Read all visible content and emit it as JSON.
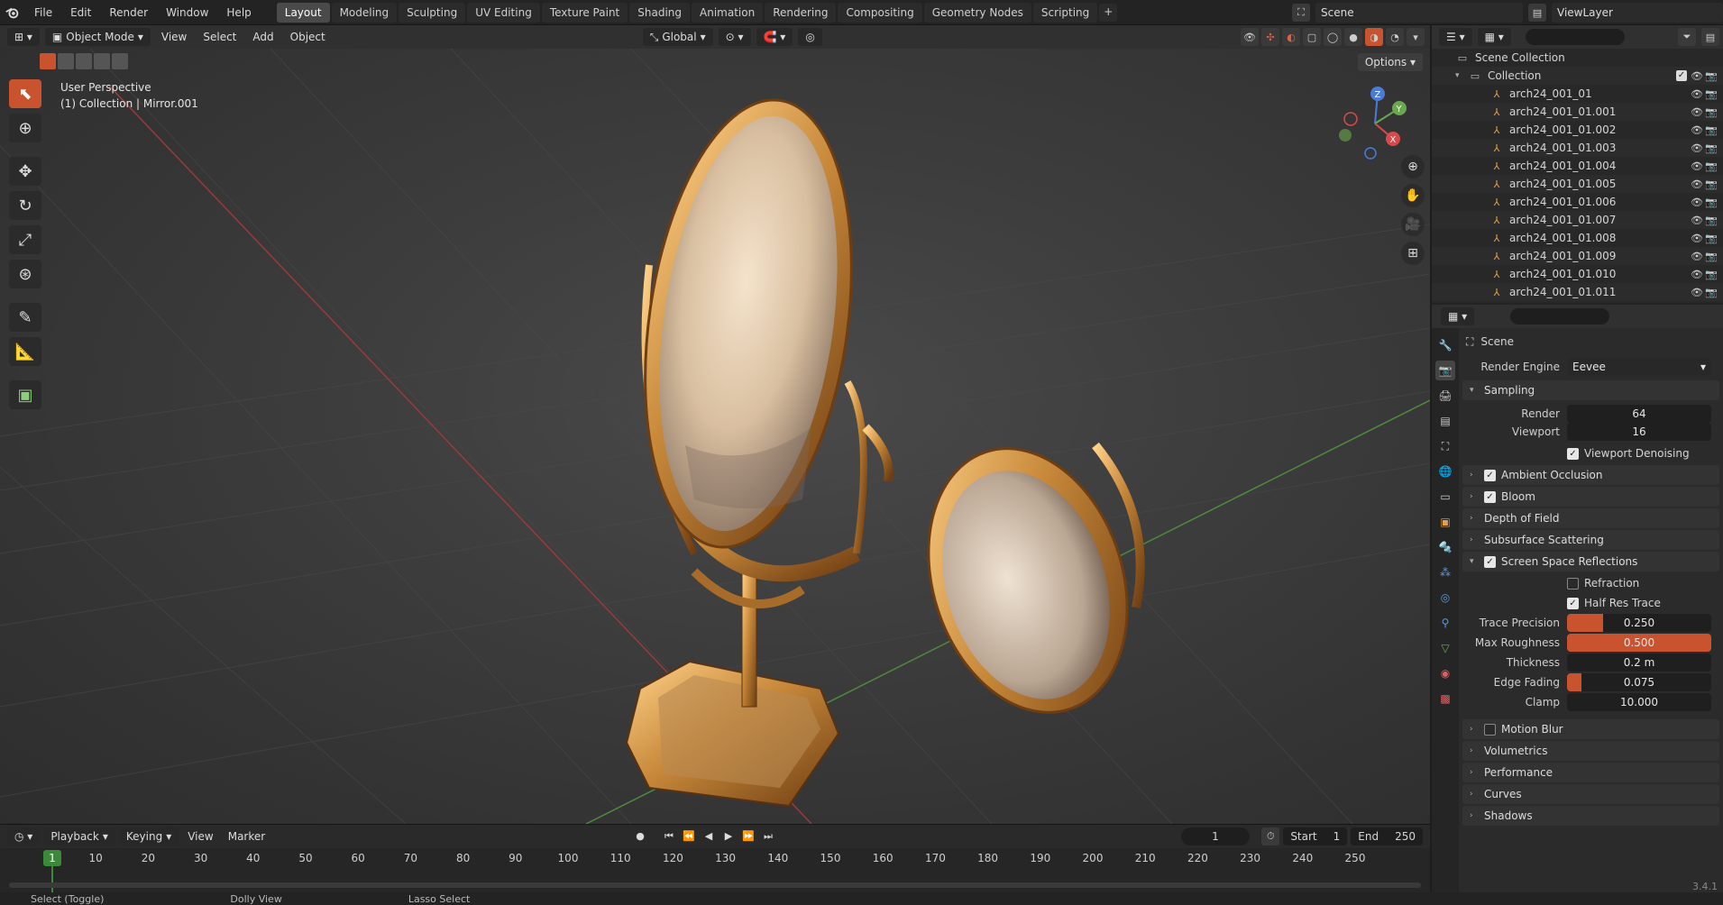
{
  "topbar": {
    "menus": [
      "File",
      "Edit",
      "Render",
      "Window",
      "Help"
    ],
    "workspaces": [
      "Layout",
      "Modeling",
      "Sculpting",
      "UV Editing",
      "Texture Paint",
      "Shading",
      "Animation",
      "Rendering",
      "Compositing",
      "Geometry Nodes",
      "Scripting"
    ],
    "active_workspace": "Layout",
    "add_tab": "+",
    "scene": "Scene",
    "view_layer": "ViewLayer"
  },
  "viewport_header": {
    "mode": "Object Mode",
    "menus": [
      "View",
      "Select",
      "Add",
      "Object"
    ],
    "transform_orientation": "Global",
    "options": "Options"
  },
  "viewport": {
    "perspective": "User Perspective",
    "context": "(1) Collection | Mirror.001",
    "gizmo_axes": [
      "Z",
      "Y",
      "X"
    ]
  },
  "timeline": {
    "menus": [
      "Playback",
      "Keying",
      "View",
      "Marker"
    ],
    "current_frame": "1",
    "frame_ticks": [
      "10",
      "20",
      "30",
      "40",
      "50",
      "60",
      "70",
      "80",
      "90",
      "100",
      "110",
      "120",
      "130",
      "140",
      "150",
      "160",
      "170",
      "180",
      "190",
      "200",
      "210",
      "220",
      "230",
      "240",
      "250"
    ],
    "current_frame_label": "1",
    "start_label": "Start",
    "start_value": "1",
    "end_label": "End",
    "end_value": "250"
  },
  "statusbar": {
    "items": [
      "Select (Toggle)",
      "Dolly View",
      "Lasso Select"
    ]
  },
  "outliner": {
    "scene_collection": "Scene Collection",
    "collection": "Collection",
    "objects": [
      "arch24_001_01",
      "arch24_001_01.001",
      "arch24_001_01.002",
      "arch24_001_01.003",
      "arch24_001_01.004",
      "arch24_001_01.005",
      "arch24_001_01.006",
      "arch24_001_01.007",
      "arch24_001_01.008",
      "arch24_001_01.009",
      "arch24_001_01.010",
      "arch24_001_01.011"
    ]
  },
  "properties": {
    "context": "Scene",
    "render_engine_label": "Render Engine",
    "render_engine": "Eevee",
    "sampling": {
      "title": "Sampling",
      "render_label": "Render",
      "render_value": "64",
      "viewport_label": "Viewport",
      "viewport_value": "16",
      "denoise_label": "Viewport Denoising"
    },
    "panels_top": [
      {
        "label": "Ambient Occlusion",
        "checkbox": true
      },
      {
        "label": "Bloom",
        "checkbox": true
      },
      {
        "label": "Depth of Field",
        "checkbox": null
      },
      {
        "label": "Subsurface Scattering",
        "checkbox": null
      }
    ],
    "ssr": {
      "title": "Screen Space Reflections",
      "refraction_label": "Refraction",
      "half_res_label": "Half Res Trace",
      "trace_precision_label": "Trace Precision",
      "trace_precision": "0.250",
      "trace_precision_fill": 0.25,
      "max_roughness_label": "Max Roughness",
      "max_roughness": "0.500",
      "max_roughness_fill": 1.0,
      "thickness_label": "Thickness",
      "thickness": "0.2 m",
      "edge_fading_label": "Edge Fading",
      "edge_fading": "0.075",
      "edge_fading_fill": 0.1,
      "clamp_label": "Clamp",
      "clamp": "10.000"
    },
    "panels_bottom": [
      {
        "label": "Motion Blur",
        "checkbox": false
      },
      {
        "label": "Volumetrics",
        "checkbox": null
      },
      {
        "label": "Performance",
        "checkbox": null
      },
      {
        "label": "Curves",
        "checkbox": null
      },
      {
        "label": "Shadows",
        "checkbox": null
      }
    ],
    "version": "3.4.1"
  },
  "colors": {
    "accent": "#c9522f",
    "current_frame": "#3a8a3a",
    "object_icon": "#e6a04a",
    "gold": "#c8893a"
  }
}
